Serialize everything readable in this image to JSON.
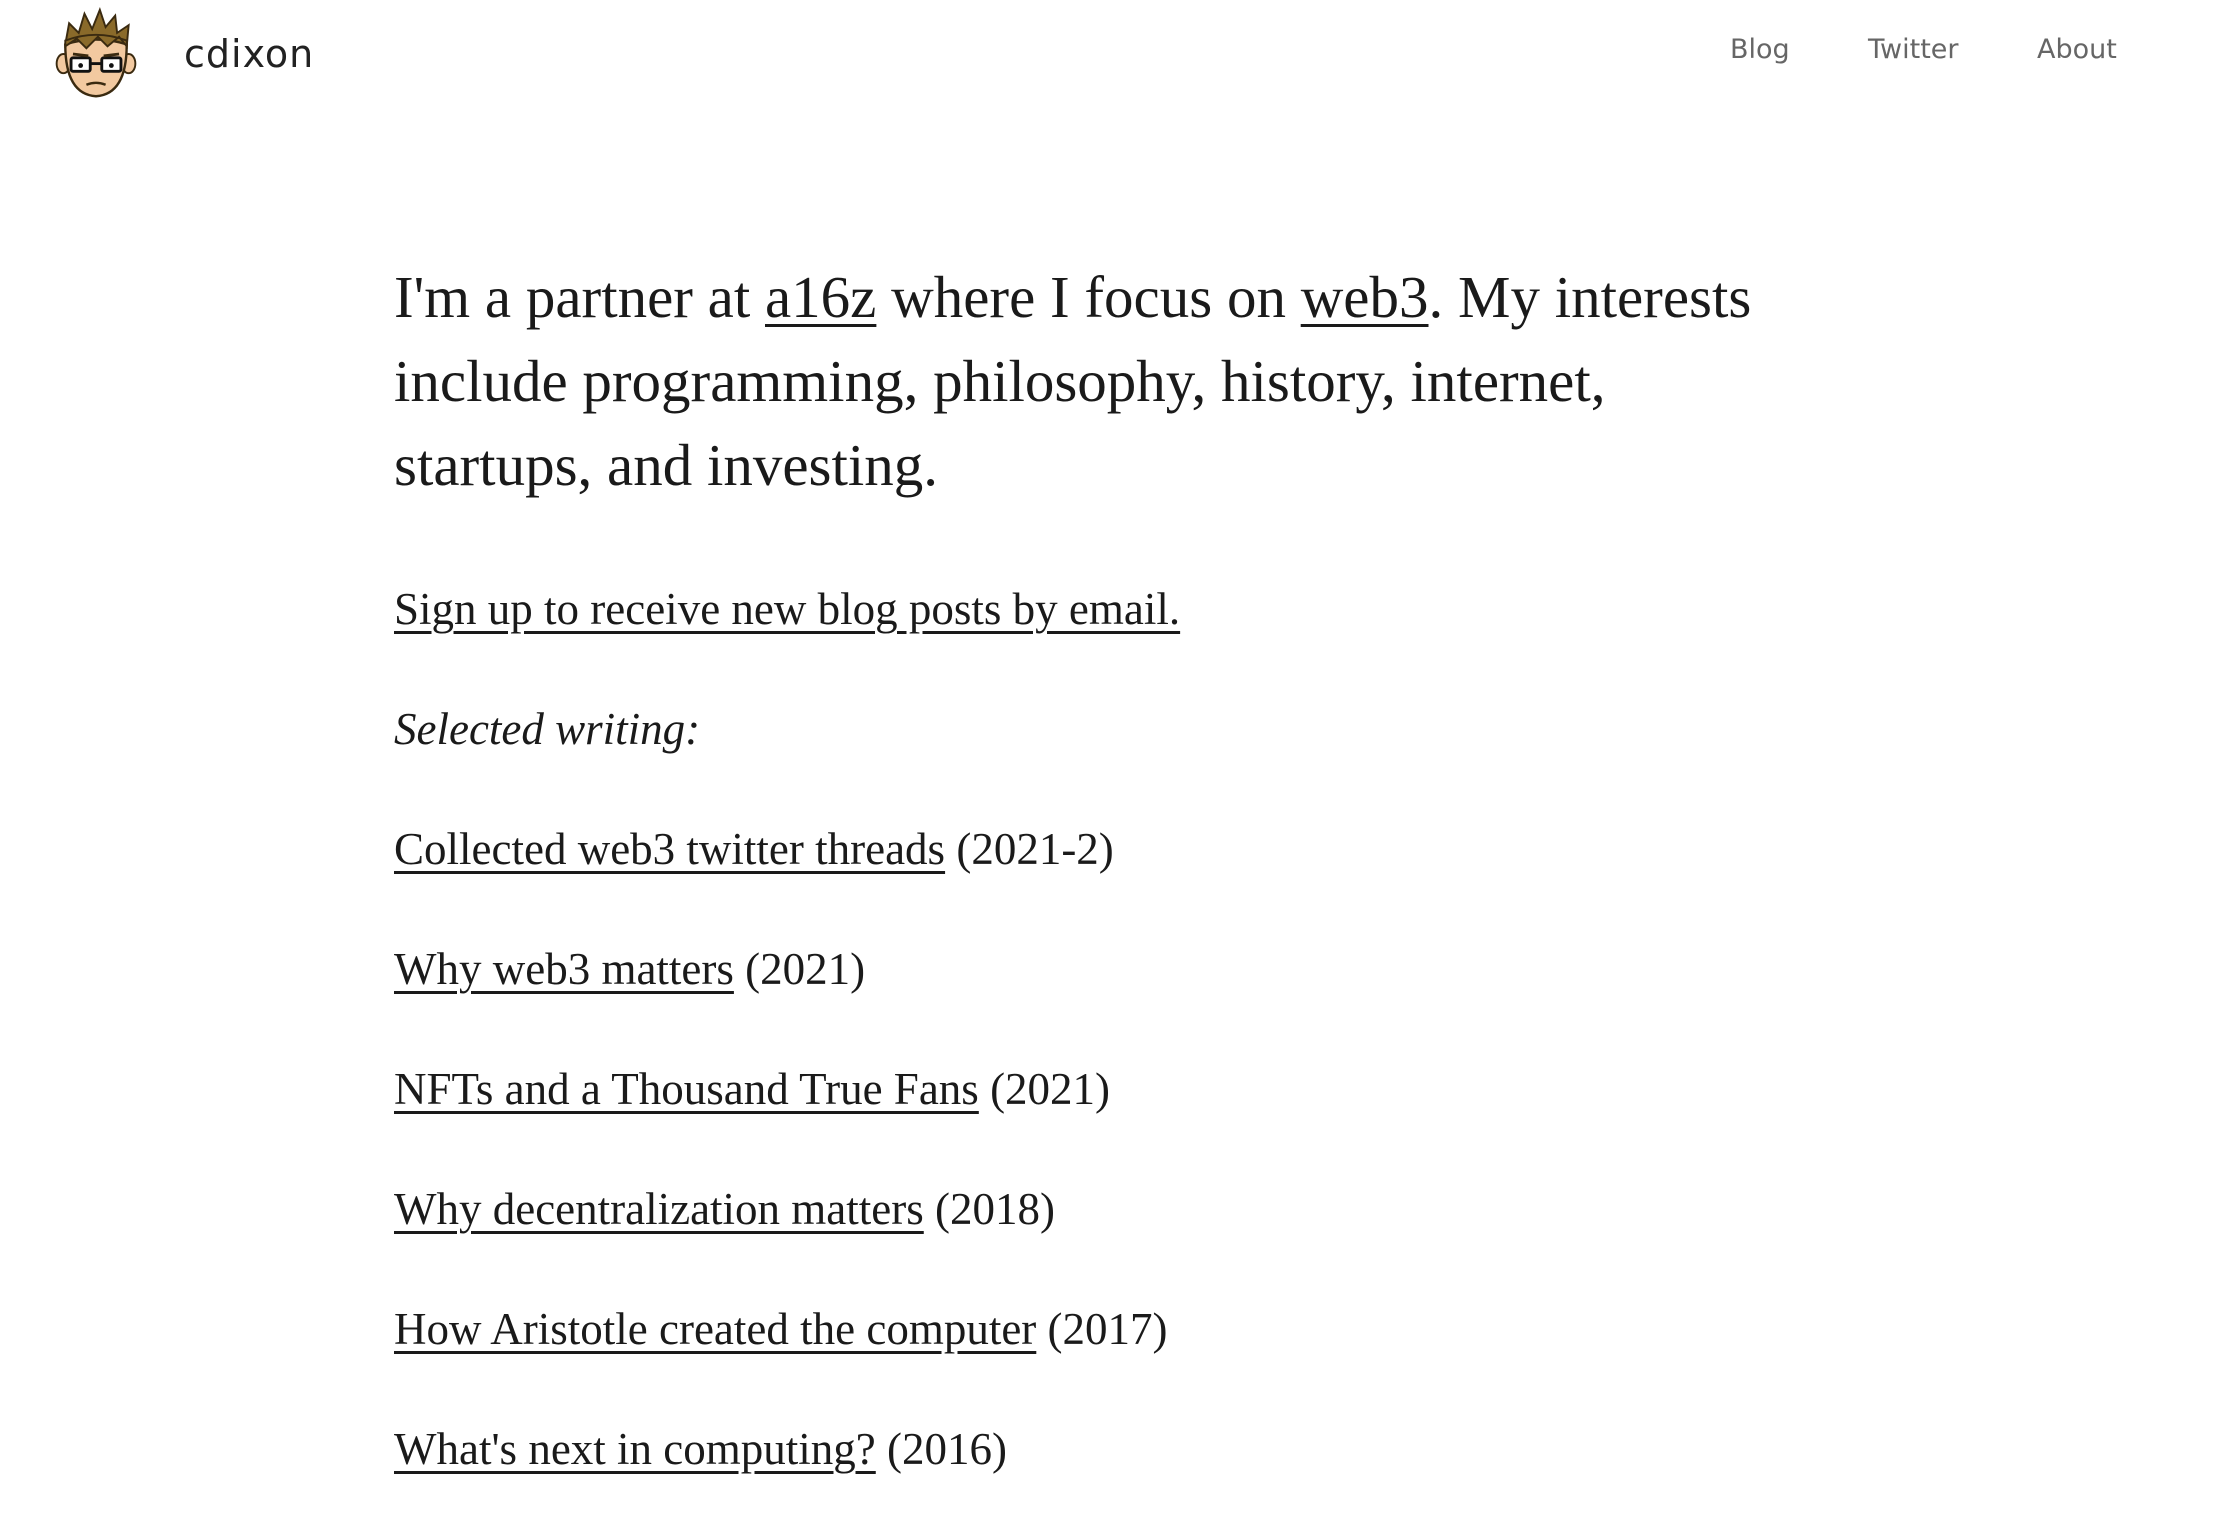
{
  "header": {
    "site_name": "cdixon",
    "avatar_icon": "cartoon-face-with-glasses-icon",
    "nav": [
      {
        "label": "Blog"
      },
      {
        "label": "Twitter"
      },
      {
        "label": "About"
      }
    ]
  },
  "intro": {
    "part1": "I'm a partner at ",
    "link_a16z": "a16z",
    "part2": " where I focus on ",
    "link_web3": "web3",
    "part3": ". My interests include programming, philosophy, history, internet, startups, and investing."
  },
  "signup_link": "Sign up to receive new blog posts by email.",
  "selected_label": "Selected writing:",
  "writings": [
    {
      "title": "Collected web3 twitter threads",
      "year": "(2021-2)"
    },
    {
      "title": "Why web3 matters",
      "year": "(2021)"
    },
    {
      "title": "NFTs and a Thousand True Fans",
      "year": "(2021)"
    },
    {
      "title": "Why decentralization matters",
      "year": "(2018)"
    },
    {
      "title": "How Aristotle created the computer",
      "year": "(2017)"
    },
    {
      "title": "What's next in computing?",
      "year": "(2016)"
    }
  ],
  "colors": {
    "text": "#1a1a1a",
    "nav": "#666666",
    "background": "#ffffff"
  }
}
